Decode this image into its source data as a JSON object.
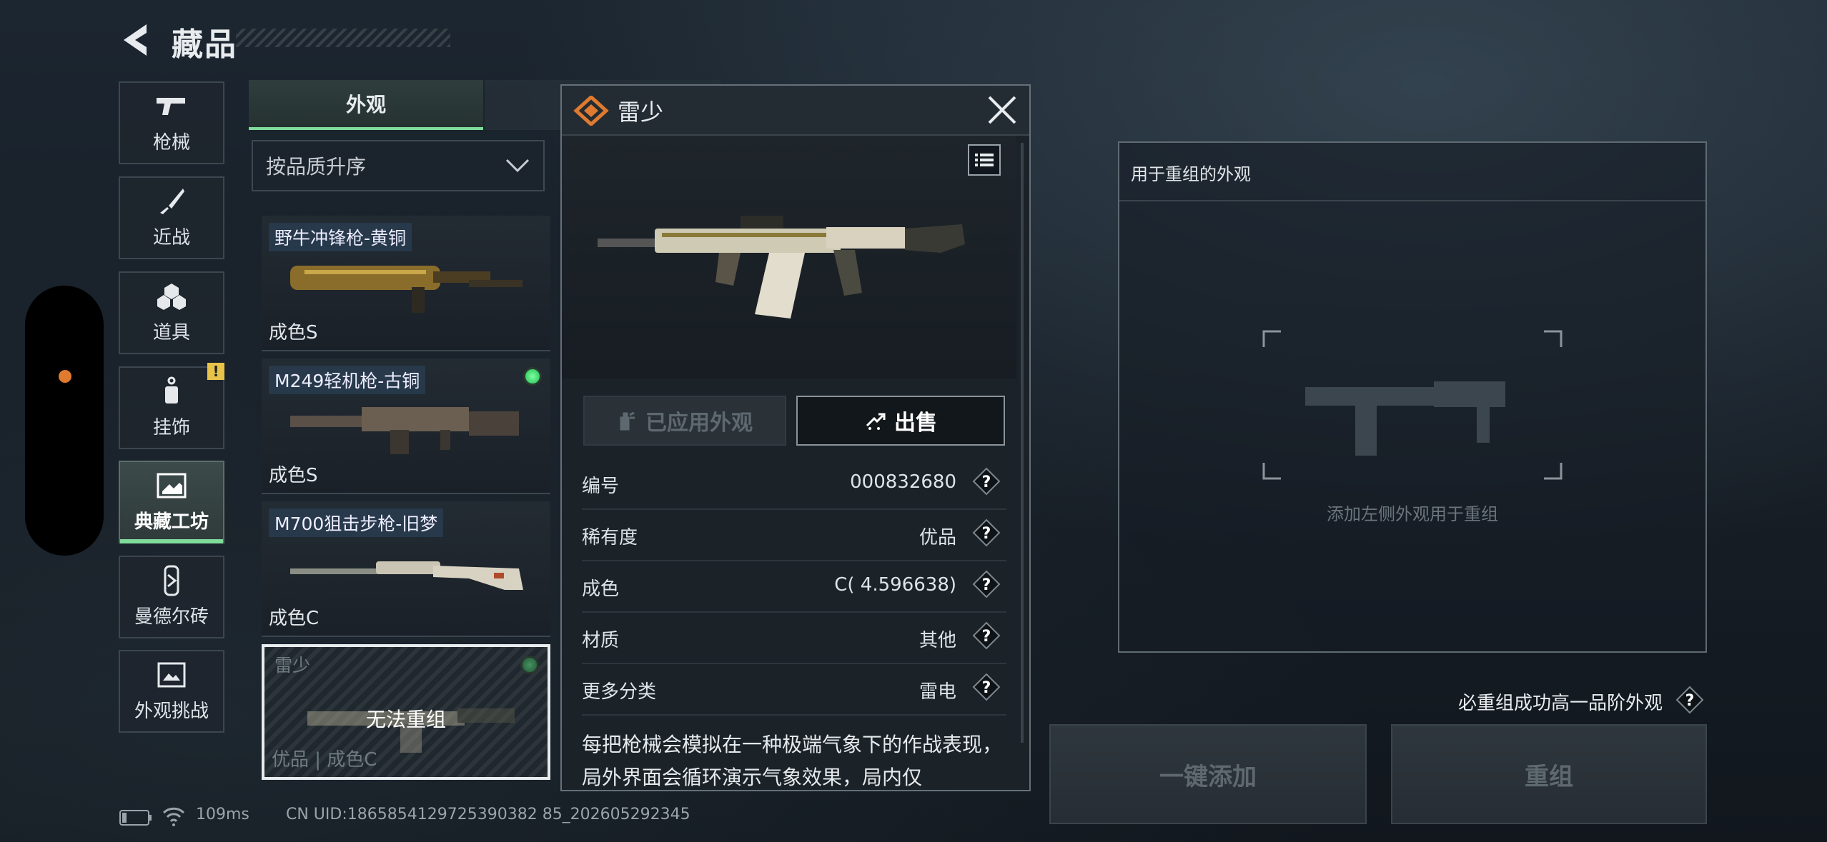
{
  "header": {
    "title": "藏品"
  },
  "categories": [
    {
      "label": "枪械",
      "icon": "gun-icon"
    },
    {
      "label": "近战",
      "icon": "knife-icon"
    },
    {
      "label": "道具",
      "icon": "grenade-icon"
    },
    {
      "label": "挂饰",
      "icon": "charm-icon"
    },
    {
      "label": "典藏工坊",
      "icon": "workshop-icon",
      "active": true
    },
    {
      "label": "曼德尔砖",
      "icon": "brick-icon"
    },
    {
      "label": "外观挑战",
      "icon": "challenge-icon"
    }
  ],
  "warning_badge": "!",
  "tabs": {
    "active": "外观"
  },
  "sort": {
    "label": "按品质升序"
  },
  "items": [
    {
      "name": "野牛冲锋枪-黄铜",
      "grade": "成色S",
      "equipped": false
    },
    {
      "name": "M249轻机枪-古铜",
      "grade": "成色S",
      "equipped": true
    },
    {
      "name": "M700狙击步枪-旧梦",
      "grade": "成色C",
      "equipped": false
    },
    {
      "name": "雷少",
      "grade": "优品 | 成色C",
      "overlay": "无法重组",
      "selected": true,
      "equipped": true
    }
  ],
  "detail": {
    "title": "雷少",
    "applied_label": "已应用外观",
    "sell_label": "出售",
    "rows": [
      {
        "key": "编号",
        "value": "000832680"
      },
      {
        "key": "稀有度",
        "value": "优品"
      },
      {
        "key": "成色",
        "value": "C( 4.596638)"
      },
      {
        "key": "材质",
        "value": "其他"
      },
      {
        "key": "更多分类",
        "value": "雷电"
      }
    ],
    "description": "每把枪械会模拟在一种极端气象下的作战表现，局外界面会循环演示气象效果，局内仅"
  },
  "rework": {
    "header": "用于重组的外观",
    "placeholder": "添加左侧外观用于重组",
    "guarantee": "必重组成功高一品阶外观",
    "add_all_label": "一键添加",
    "rework_label": "重组"
  },
  "status": {
    "ping": "109ms",
    "uid": "CN UID:1865854129725390382 85_202605292345"
  },
  "colors": {
    "accent": "#7fdc9a",
    "brand": "#e07a2f",
    "warning": "#e8c34a"
  }
}
